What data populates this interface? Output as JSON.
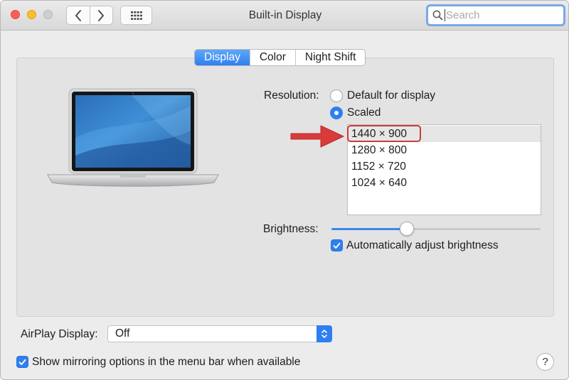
{
  "window": {
    "title": "Built-in Display"
  },
  "toolbar": {
    "back_icon": "chevron-left-icon",
    "forward_icon": "chevron-right-icon",
    "show_all_icon": "grid-icon"
  },
  "search": {
    "placeholder": "Search",
    "value": ""
  },
  "tabs": [
    {
      "label": "Display",
      "active": true
    },
    {
      "label": "Color",
      "active": false
    },
    {
      "label": "Night Shift",
      "active": false
    }
  ],
  "resolution": {
    "label": "Resolution:",
    "options": [
      {
        "label": "Default for display",
        "checked": false
      },
      {
        "label": "Scaled",
        "checked": true
      }
    ],
    "scaled_list": [
      {
        "label": "1440 × 900",
        "selected": true
      },
      {
        "label": "1280 × 800",
        "selected": false
      },
      {
        "label": "1152 × 720",
        "selected": false
      },
      {
        "label": "1024 × 640",
        "selected": false
      }
    ]
  },
  "brightness": {
    "label": "Brightness:",
    "level": 0.36,
    "auto_adjust_label": "Automatically adjust brightness",
    "auto_adjust_checked": true
  },
  "airplay": {
    "label": "AirPlay Display:",
    "selected": "Off"
  },
  "mirroring": {
    "label": "Show mirroring options in the menu bar when available",
    "checked": true
  },
  "help": {
    "label": "?"
  },
  "colors": {
    "accent": "#2e7ff0",
    "annotation_red": "#cf3a3a"
  }
}
